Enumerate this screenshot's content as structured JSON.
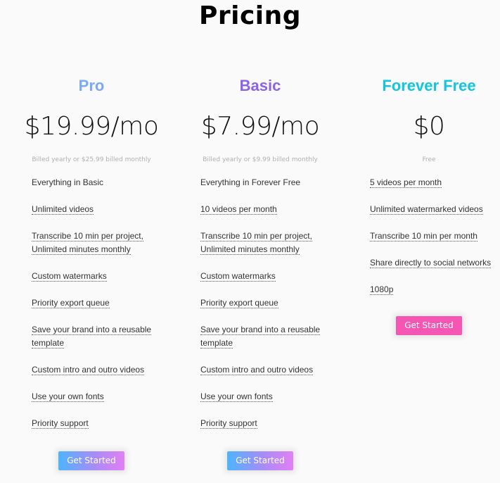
{
  "header": {
    "title": "Pricing"
  },
  "colors": {
    "pro": "#7aaaf7",
    "basic": "#8c62e6",
    "free": "#12c6dd",
    "gradient_start": "#4db4ff",
    "gradient_end": "#e27ff5",
    "pink": "#f556b4"
  },
  "plans": [
    {
      "name": "Pro",
      "price": "$19.99/mo",
      "billing": "Billed yearly or $25.99 billed monthly",
      "features": [
        "Everything in Basic",
        "Unlimited videos",
        "Transcribe 10 min per project, Unlimited minutes monthly",
        "Custom watermarks",
        "Priority export queue",
        "Save your brand into a reusable template",
        "Custom intro and outro videos",
        "Use your own fonts",
        "Priority support"
      ],
      "cta": "Get Started"
    },
    {
      "name": "Basic",
      "price": "$7.99/mo",
      "billing": "Billed yearly or $9.99 billed monthly",
      "features": [
        "Everything in Forever Free",
        "10 videos per month",
        "Transcribe 10 min per project, Unlimited minutes monthly",
        "Custom watermarks",
        "Priority export queue",
        "Save your brand into a reusable template",
        "Custom intro and outro videos",
        "Use your own fonts",
        "Priority support"
      ],
      "cta": "Get Started"
    },
    {
      "name": "Forever Free",
      "price": "$0",
      "billing": "Free",
      "features": [
        "5 videos per month",
        "Unlimited watermarked videos",
        "Transcribe 10 min per month",
        "Share directly to social networks",
        "1080p"
      ],
      "cta": "Get Started"
    }
  ]
}
